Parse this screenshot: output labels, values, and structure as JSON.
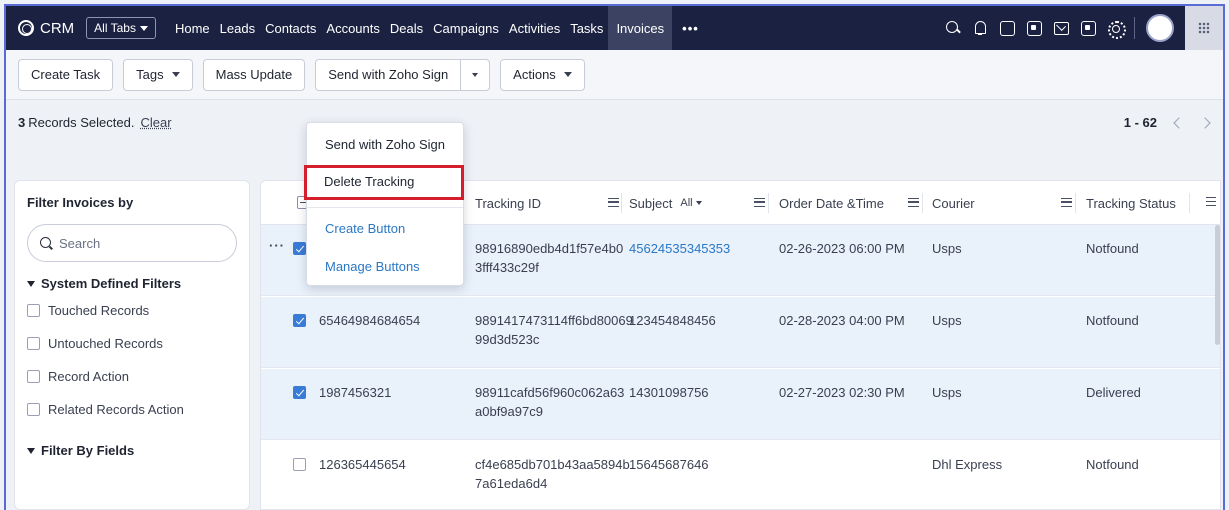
{
  "nav": {
    "brand": "CRM",
    "all_tabs": "All Tabs",
    "tabs": [
      "Home",
      "Leads",
      "Contacts",
      "Accounts",
      "Deals",
      "Campaigns",
      "Activities",
      "Tasks",
      "Invoices"
    ],
    "active_tab": "Invoices",
    "more": "•••"
  },
  "toolbar": {
    "create_task": "Create Task",
    "tags": "Tags",
    "mass_update": "Mass Update",
    "send_zoho_sign": "Send with Zoho Sign",
    "actions": "Actions"
  },
  "selection": {
    "count": "3",
    "label": "Records Selected.",
    "clear": "Clear",
    "range": "1 - 62"
  },
  "filter": {
    "title": "Filter Invoices by",
    "search_placeholder": "Search",
    "system_group": "System Defined Filters",
    "items": [
      "Touched Records",
      "Untouched Records",
      "Record Action",
      "Related Records Action"
    ],
    "fields_group": "Filter By Fields"
  },
  "dropdown": {
    "items": [
      "Send with Zoho Sign",
      "Delete Tracking",
      "Create Button",
      "Manage Buttons"
    ],
    "highlighted": "Delete Tracking"
  },
  "table": {
    "columns": {
      "tracking_id": "Tracking ID",
      "subject": "Subject",
      "subject_filter": "All",
      "order_date": "Order Date &Time",
      "courier": "Courier",
      "status": "Tracking Status"
    },
    "rows": [
      {
        "selected": true,
        "number": "",
        "tracking_1": "98916890edb4d1f57e4b0",
        "tracking_2": "3fff433c29f",
        "subject": "45624535345353",
        "date": "02-26-2023 06:00 PM",
        "courier": "Usps",
        "status": "Notfound"
      },
      {
        "selected": true,
        "number": "65464984684654",
        "tracking_1": "9891417473114ff6bd80069",
        "tracking_2": "99d3d523c",
        "subject": "123454848456",
        "date": "02-28-2023 04:00 PM",
        "courier": "Usps",
        "status": "Notfound"
      },
      {
        "selected": true,
        "number": "1987456321",
        "tracking_1": "98911cafd56f960c062a63",
        "tracking_2": "a0bf9a97c9",
        "subject": "14301098756",
        "date": "02-27-2023 02:30 PM",
        "courier": "Usps",
        "status": "Delivered"
      },
      {
        "selected": false,
        "number": "126365445654",
        "tracking_1": "cf4e685db701b43aa5894b",
        "tracking_2": "7a61eda6d4",
        "subject": "15645687646",
        "date": "",
        "courier": "Dhl Express",
        "status": "Notfound"
      }
    ]
  },
  "colors": {
    "nav_bg": "#1b2140",
    "accent": "#2b78c5",
    "highlight": "#d41e2b",
    "selected_row": "#e9f1fb"
  }
}
